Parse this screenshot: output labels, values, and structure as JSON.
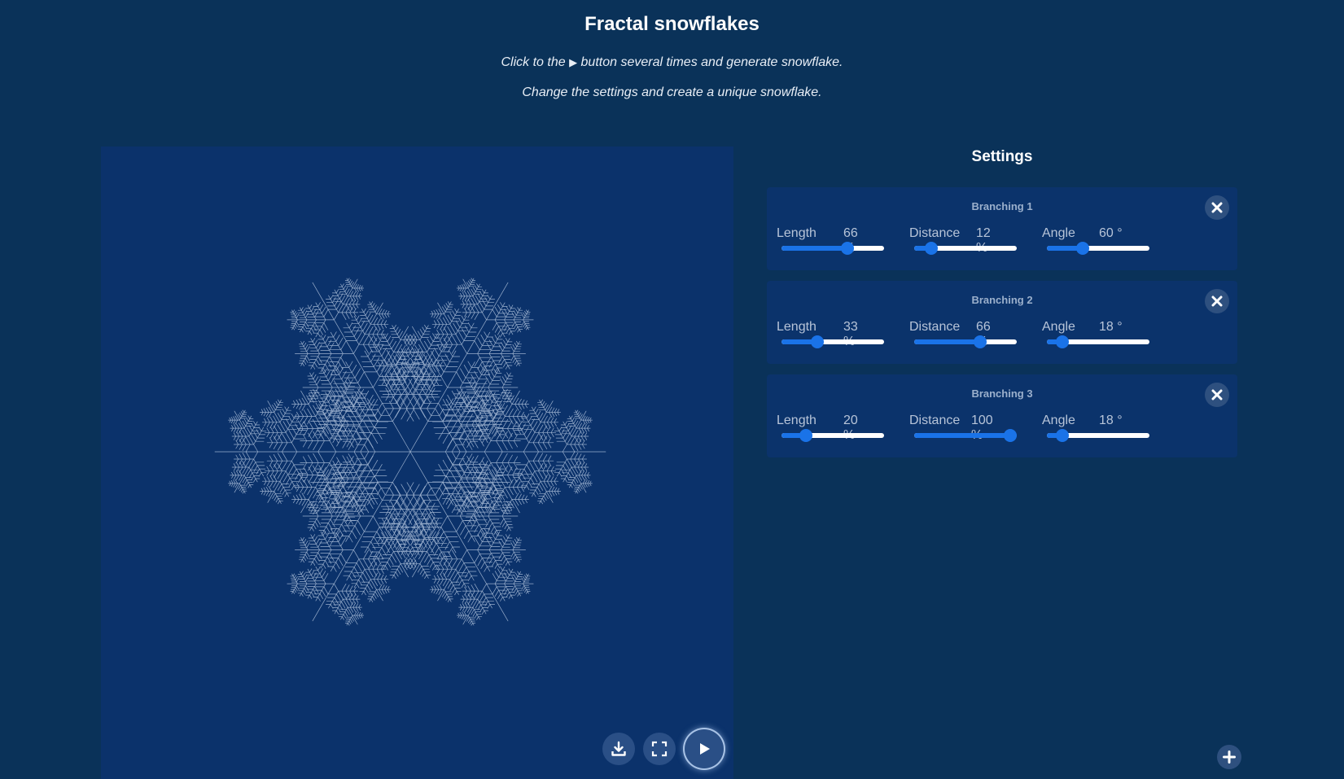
{
  "header": {
    "title": "Fractal snowflakes",
    "intro_line1_before": "Click to the ",
    "intro_line1_icon": "▶",
    "intro_line1_after": " button several times and generate snowflake.",
    "intro_line2": "Change the settings and create a unique snowflake."
  },
  "canvas": {
    "background": "#0b326b",
    "snowflake_color": "#c9d8ec",
    "controls": {
      "download_icon": "download-icon",
      "fullscreen_icon": "fullscreen-icon",
      "play_icon": "play-icon"
    }
  },
  "settings": {
    "title": "Settings",
    "accent_color": "#1a73e8",
    "branchings": [
      {
        "title": "Branching 1",
        "length": {
          "label": "Length",
          "value": 66,
          "unit": "%",
          "display": "66 %"
        },
        "distance": {
          "label": "Distance",
          "value": 12,
          "unit": "%",
          "display": "12 %"
        },
        "angle": {
          "label": "Angle",
          "value": 60,
          "unit": "°",
          "display": "60 °",
          "fraction": 0.33
        }
      },
      {
        "title": "Branching 2",
        "length": {
          "label": "Length",
          "value": 33,
          "unit": "%",
          "display": "33 %"
        },
        "distance": {
          "label": "Distance",
          "value": 66,
          "unit": "%",
          "display": "66 %"
        },
        "angle": {
          "label": "Angle",
          "value": 18,
          "unit": "°",
          "display": "18 °",
          "fraction": 0.1
        }
      },
      {
        "title": "Branching 3",
        "length": {
          "label": "Length",
          "value": 20,
          "unit": "%",
          "display": "20 %"
        },
        "distance": {
          "label": "Distance",
          "value": 100,
          "unit": "%",
          "display": "100 %"
        },
        "angle": {
          "label": "Angle",
          "value": 18,
          "unit": "°",
          "display": "18 °",
          "fraction": 0.1
        }
      }
    ],
    "add_icon": "plus-icon",
    "close_icon": "close-icon"
  }
}
